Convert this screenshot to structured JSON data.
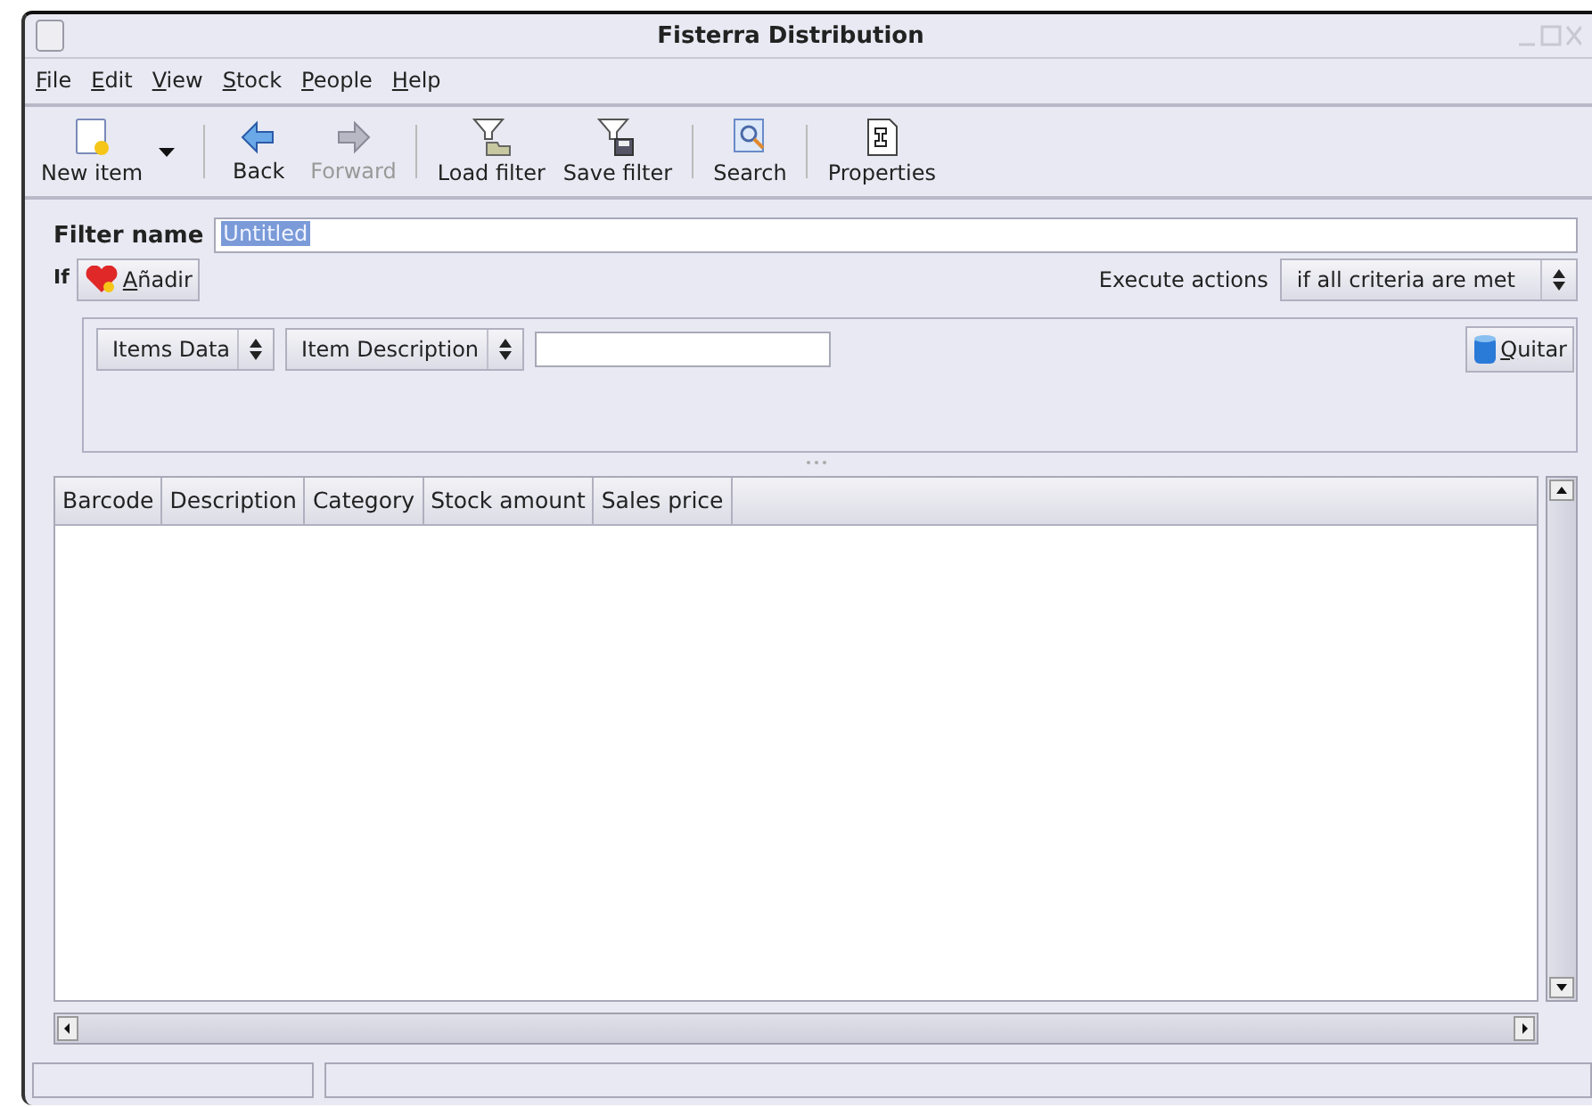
{
  "window": {
    "title": "Fisterra Distribution"
  },
  "menu": [
    "File",
    "Edit",
    "View",
    "Stock",
    "People",
    "Help"
  ],
  "toolbar": [
    [
      {
        "kind": "new",
        "label": "New item",
        "disabled": false,
        "dropdown": true
      }
    ],
    [
      {
        "kind": "back",
        "label": "Back",
        "disabled": false,
        "dropdown": false
      },
      {
        "kind": "forward",
        "label": "Forward",
        "disabled": true,
        "dropdown": false
      }
    ],
    [
      {
        "kind": "load",
        "label": "Load filter",
        "disabled": false,
        "dropdown": false
      },
      {
        "kind": "save",
        "label": "Save filter",
        "disabled": false,
        "dropdown": false
      }
    ],
    [
      {
        "kind": "search",
        "label": "Search",
        "disabled": false,
        "dropdown": false
      }
    ],
    [
      {
        "kind": "properties",
        "label": "Properties",
        "disabled": false,
        "dropdown": false
      }
    ]
  ],
  "filter": {
    "label": "Filter name",
    "value": "Untitled"
  },
  "condition": {
    "label": "If",
    "add_button": "Añadir",
    "execute_label": "Execute actions",
    "execute_value": "if all criteria are met"
  },
  "criterion": {
    "source": "Items Data",
    "field": "Item Description",
    "remove_button": "Quitar"
  },
  "table": {
    "columns": [
      "Barcode",
      "Description",
      "Category",
      "Stock amount",
      "Sales price"
    ]
  }
}
